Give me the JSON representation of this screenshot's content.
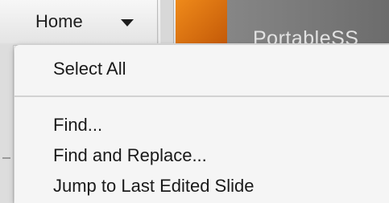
{
  "toolbar": {
    "home_label": "Home",
    "preview_title": "PortableSS"
  },
  "menu": {
    "items": [
      {
        "label": "Select All"
      },
      {
        "label": "Find..."
      },
      {
        "label": "Find and Replace..."
      },
      {
        "label": "Jump to Last Edited Slide"
      }
    ]
  }
}
